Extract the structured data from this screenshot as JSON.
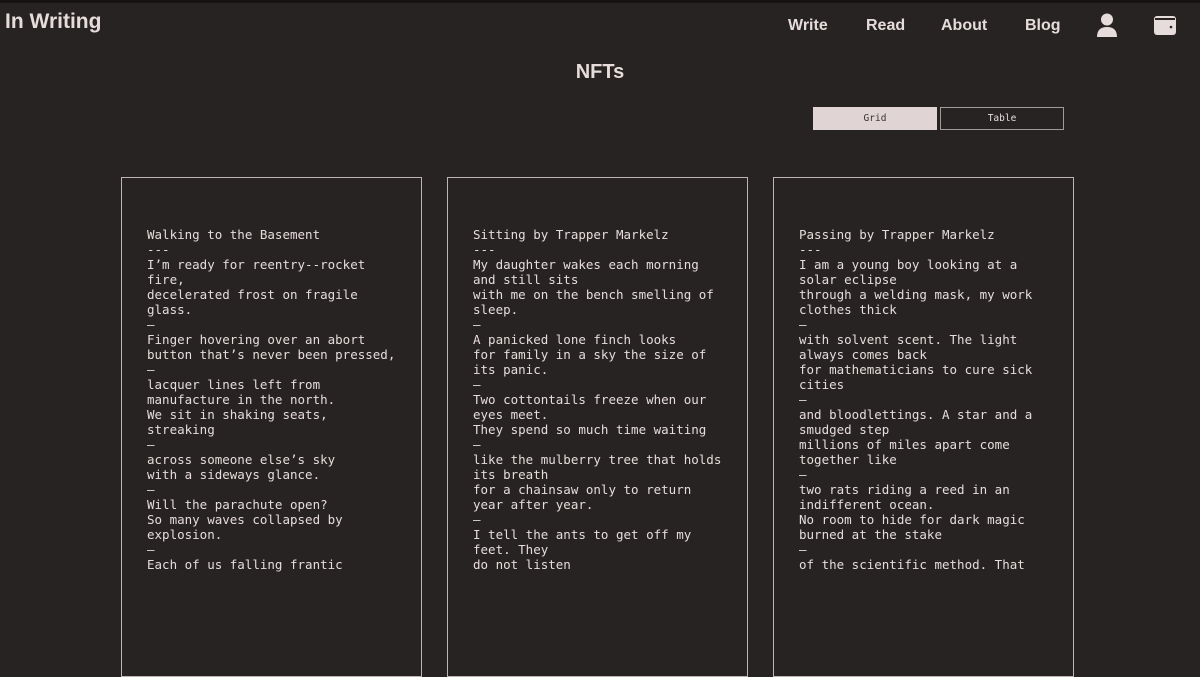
{
  "header": {
    "brand": "In Writing",
    "nav": [
      "Write",
      "Read",
      "About",
      "Blog"
    ],
    "icons": [
      "user-icon",
      "wallet-icon"
    ]
  },
  "page": {
    "title": "NFTs"
  },
  "view_toggle": {
    "grid": "Grid",
    "table": "Table",
    "selected": "Grid"
  },
  "colors": {
    "background": "#262322",
    "text": "#e6dcdc",
    "active_toggle": "#e0d4d4"
  },
  "cards": [
    {
      "title": "Walking to the Basement",
      "lines": [
        "---",
        "I’m ready for reentry--rocket fire,",
        "decelerated frost on fragile glass.",
        "–",
        "Finger hovering over an abort",
        "button that’s never been pressed,",
        "–",
        "lacquer lines left from",
        "manufacture in the north.",
        "We sit in shaking seats, streaking",
        "–",
        "across someone else’s sky",
        "with a sideways glance.",
        "–",
        "Will the parachute open?",
        "So many waves collapsed by explosion.",
        "–",
        "Each of us falling frantic"
      ]
    },
    {
      "title": "Sitting by Trapper Markelz",
      "lines": [
        "---",
        "My daughter wakes each morning and still sits",
        "with me on the bench smelling of sleep.",
        "–",
        "A panicked lone finch looks",
        "for family in a sky the size of its panic.",
        "–",
        "Two cottontails freeze when our eyes meet.",
        "They spend so much time waiting",
        "–",
        "like the mulberry tree that holds its breath",
        "for a chainsaw only to return year after year.",
        "–",
        "I tell the ants to get off my feet. They",
        "do not listen"
      ]
    },
    {
      "title": "Passing by Trapper Markelz",
      "lines": [
        "---",
        "I am a young boy looking at a solar eclipse",
        "through a welding mask, my work clothes thick",
        "–",
        "with solvent scent. The light always comes back",
        "for mathematicians to cure sick cities",
        "–",
        "and bloodlettings. A star and a smudged step",
        "millions of miles apart come together like",
        "–",
        "two rats riding a reed in an indifferent ocean.",
        "No room to hide for dark magic burned at the stake",
        "–",
        "of the scientific method. That"
      ]
    }
  ]
}
